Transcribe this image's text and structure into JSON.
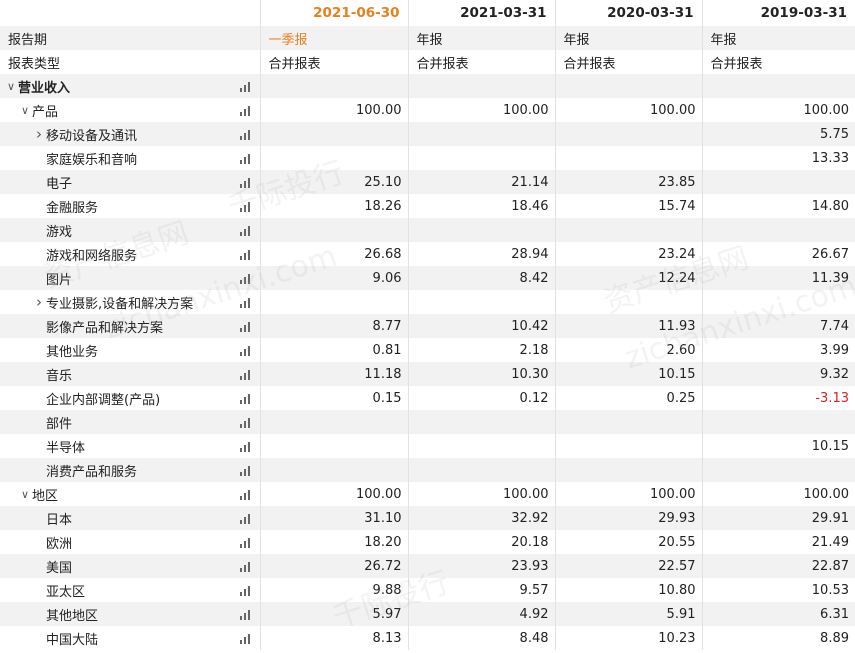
{
  "header": {
    "dates": [
      "2021-06-30",
      "2021-03-31",
      "2020-03-31",
      "2019-03-31"
    ]
  },
  "meta_rows": [
    {
      "label": "报告期",
      "values": [
        "一季报",
        "年报",
        "年报",
        "年报"
      ]
    },
    {
      "label": "报表类型",
      "values": [
        "合并报表",
        "合并报表",
        "合并报表",
        "合并报表"
      ]
    }
  ],
  "rows": [
    {
      "label": "营业收入",
      "level": 0,
      "arrow": "down",
      "bold": true,
      "values": [
        "",
        "",
        "",
        ""
      ]
    },
    {
      "label": "产品",
      "level": 1,
      "arrow": "down",
      "values": [
        "100.00",
        "100.00",
        "100.00",
        "100.00"
      ]
    },
    {
      "label": "移动设备及通讯",
      "level": 2,
      "arrow": "right",
      "values": [
        "",
        "",
        "",
        "5.75"
      ]
    },
    {
      "label": "家庭娱乐和音响",
      "level": 2,
      "arrow": "",
      "values": [
        "",
        "",
        "",
        "13.33"
      ]
    },
    {
      "label": "电子",
      "level": 2,
      "arrow": "",
      "values": [
        "25.10",
        "21.14",
        "23.85",
        ""
      ]
    },
    {
      "label": "金融服务",
      "level": 2,
      "arrow": "",
      "values": [
        "18.26",
        "18.46",
        "15.74",
        "14.80"
      ]
    },
    {
      "label": "游戏",
      "level": 2,
      "arrow": "",
      "values": [
        "",
        "",
        "",
        ""
      ]
    },
    {
      "label": "游戏和网络服务",
      "level": 2,
      "arrow": "",
      "values": [
        "26.68",
        "28.94",
        "23.24",
        "26.67"
      ]
    },
    {
      "label": "图片",
      "level": 2,
      "arrow": "",
      "values": [
        "9.06",
        "8.42",
        "12.24",
        "11.39"
      ]
    },
    {
      "label": "专业摄影,设备和解决方案",
      "level": 2,
      "arrow": "right",
      "values": [
        "",
        "",
        "",
        ""
      ]
    },
    {
      "label": "影像产品和解决方案",
      "level": 2,
      "arrow": "",
      "values": [
        "8.77",
        "10.42",
        "11.93",
        "7.74"
      ]
    },
    {
      "label": "其他业务",
      "level": 2,
      "arrow": "",
      "values": [
        "0.81",
        "2.18",
        "2.60",
        "3.99"
      ]
    },
    {
      "label": "音乐",
      "level": 2,
      "arrow": "",
      "values": [
        "11.18",
        "10.30",
        "10.15",
        "9.32"
      ]
    },
    {
      "label": "企业内部调整(产品)",
      "level": 2,
      "arrow": "",
      "values": [
        "0.15",
        "0.12",
        "0.25",
        "-3.13"
      ]
    },
    {
      "label": "部件",
      "level": 2,
      "arrow": "",
      "values": [
        "",
        "",
        "",
        ""
      ]
    },
    {
      "label": "半导体",
      "level": 2,
      "arrow": "",
      "values": [
        "",
        "",
        "",
        "10.15"
      ]
    },
    {
      "label": "消费产品和服务",
      "level": 2,
      "arrow": "",
      "values": [
        "",
        "",
        "",
        ""
      ]
    },
    {
      "label": "地区",
      "level": 1,
      "arrow": "down",
      "values": [
        "100.00",
        "100.00",
        "100.00",
        "100.00"
      ]
    },
    {
      "label": "日本",
      "level": 2,
      "arrow": "",
      "values": [
        "31.10",
        "32.92",
        "29.93",
        "29.91"
      ]
    },
    {
      "label": "欧洲",
      "level": 2,
      "arrow": "",
      "values": [
        "18.20",
        "20.18",
        "20.55",
        "21.49"
      ]
    },
    {
      "label": "美国",
      "level": 2,
      "arrow": "",
      "values": [
        "26.72",
        "23.93",
        "22.57",
        "22.87"
      ]
    },
    {
      "label": "亚太区",
      "level": 2,
      "arrow": "",
      "values": [
        "9.88",
        "9.57",
        "10.80",
        "10.53"
      ]
    },
    {
      "label": "其他地区",
      "level": 2,
      "arrow": "",
      "values": [
        "5.97",
        "4.92",
        "5.91",
        "6.31"
      ]
    },
    {
      "label": "中国大陆",
      "level": 2,
      "arrow": "",
      "values": [
        "8.13",
        "8.48",
        "10.23",
        "8.89"
      ]
    }
  ],
  "watermarks": [
    "千际投行",
    "资产信息网",
    "zichanxinxi.com"
  ],
  "colors": {
    "accent": "#e8801e",
    "negative": "#e02020",
    "stripe": "#f2f2f2"
  },
  "icons": {
    "expanded": "chevron-down-icon",
    "collapsed": "chevron-right-icon",
    "chart": "bar-chart-icon"
  }
}
